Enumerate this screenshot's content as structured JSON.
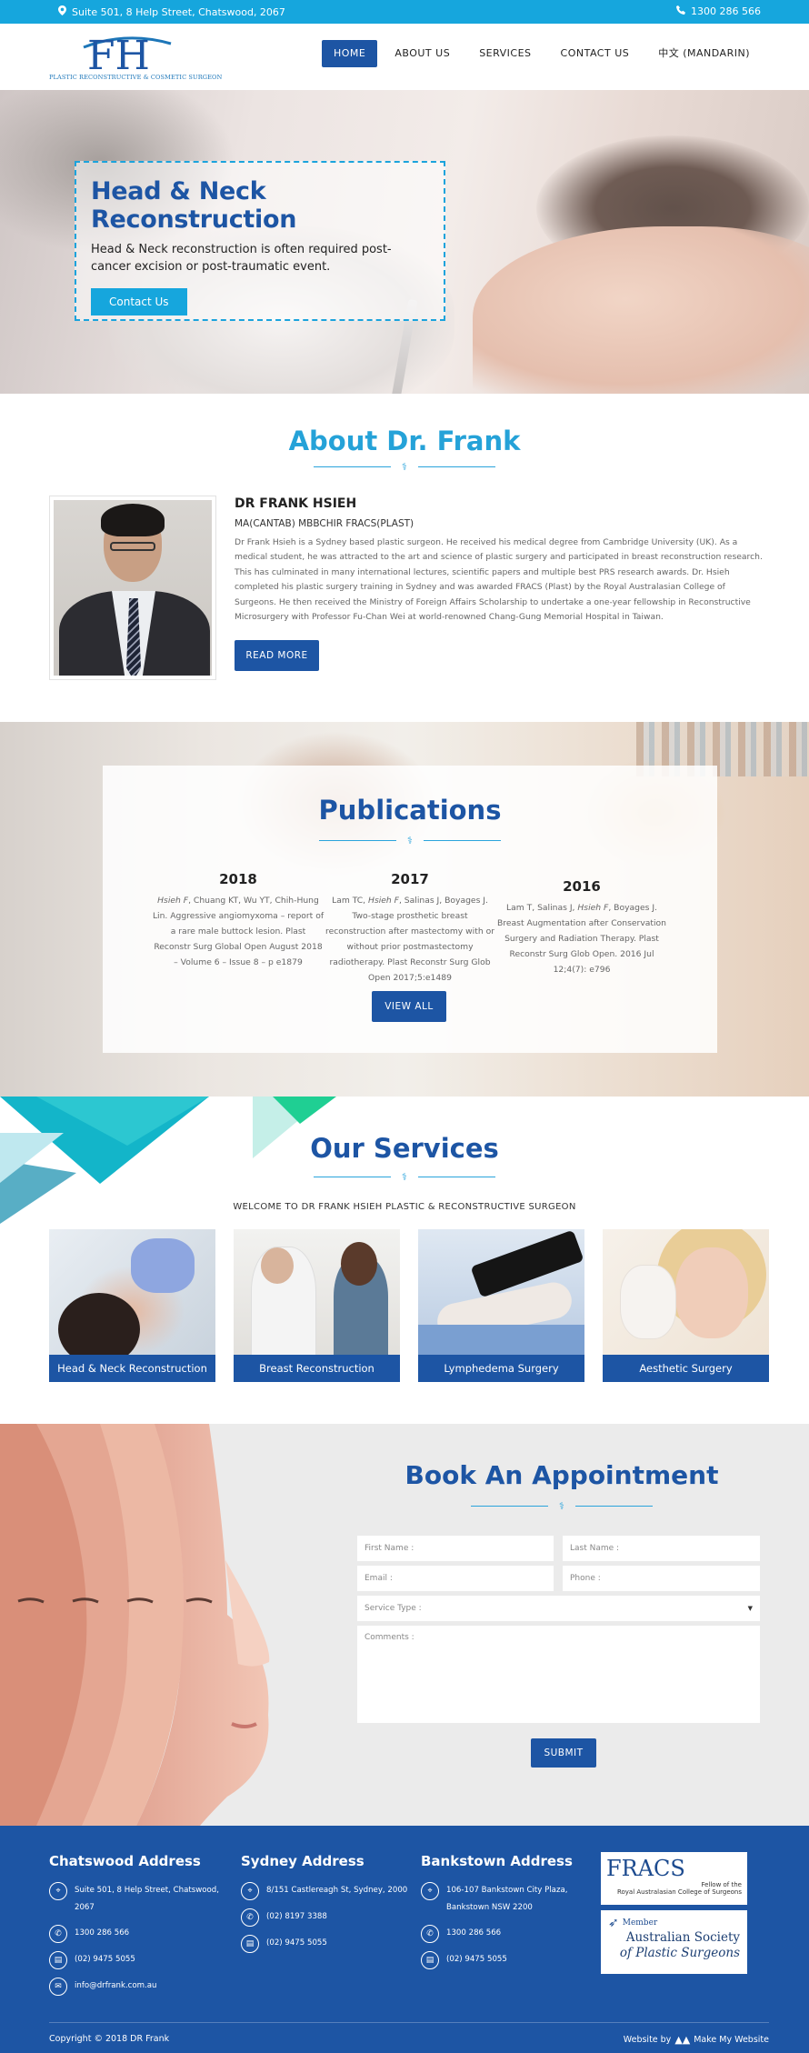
{
  "topbar": {
    "address": "Suite 501, 8 Help Street, Chatswood, 2067",
    "phone": "1300 286 566"
  },
  "logo": {
    "monogram": "FH",
    "tagline": "PLASTIC RECONSTRUCTIVE & COSMETIC SURGEON"
  },
  "nav": {
    "items": [
      "HOME",
      "ABOUT US",
      "SERVICES",
      "CONTACT US",
      "中文 (MANDARIN)"
    ]
  },
  "hero": {
    "title": "Head & Neck Reconstruction",
    "text": "Head & Neck reconstruction is often required post-cancer excision or post-traumatic event.",
    "button": "Contact Us"
  },
  "about": {
    "title": "About Dr. Frank",
    "name": "DR FRANK HSIEH",
    "credentials": "MA(CANTAB) MBBCHIR FRACS(PLAST)",
    "bio": "Dr Frank Hsieh is a Sydney based plastic surgeon. He received his medical degree from Cambridge University (UK). As a medical student, he was attracted to the art and science of plastic surgery and participated in breast reconstruction research. This has culminated in many international lectures, scientific papers and multiple best PRS research awards. Dr. Hsieh completed his plastic surgery training in Sydney and was awarded FRACS (Plast) by the Royal Australasian College of Surgeons. He then received the Ministry of Foreign Affairs Scholarship to undertake a one-year fellowship in Reconstructive Microsurgery with Professor Fu-Chan Wei at world-renowned Chang-Gung Memorial Hospital in Taiwan.",
    "button": "READ MORE"
  },
  "publications": {
    "title": "Publications",
    "items": [
      {
        "year": "2018",
        "lead": "Hsieh F",
        "text": ", Chuang KT, Wu YT, Chih-Hung Lin. Aggressive angiomyxoma – report of a rare male buttock lesion. Plast Reconstr Surg Global Open August 2018 – Volume 6 – Issue 8 – p e1879"
      },
      {
        "year": "2017",
        "pre": "Lam TC, ",
        "lead": "Hsieh F",
        "text": ", Salinas J, Boyages J. Two-stage prosthetic breast reconstruction after mastectomy with or without prior postmastectomy radiotherapy. Plast Reconstr Surg Glob Open 2017;5:e1489"
      },
      {
        "year": "2016",
        "pre": "Lam T, Salinas J, ",
        "lead": "Hsieh F",
        "text": ", Boyages J. Breast Augmentation after Conservation Surgery and Radiation Therapy. Plast Reconstr Surg Glob Open. 2016 Jul 12;4(7): e796"
      }
    ],
    "button": "VIEW ALL"
  },
  "services": {
    "title": "Our Services",
    "subtitle": "WELCOME TO DR FRANK HSIEH PLASTIC & RECONSTRUCTIVE SURGEON",
    "items": [
      "Head & Neck Reconstruction",
      "Breast Reconstruction",
      "Lymphedema Surgery",
      "Aesthetic Surgery"
    ]
  },
  "appointment": {
    "title": "Book An Appointment",
    "first_name": "First Name :",
    "last_name": "Last Name :",
    "email": "Email :",
    "phone": "Phone :",
    "service_type": "Service Type :",
    "comments": "Comments :",
    "submit": "SUBMIT"
  },
  "footer": {
    "chatswood": {
      "title": "Chatswood Address",
      "address": "Suite 501, 8 Help Street, Chatswood, 2067",
      "phone": "1300 286 566",
      "fax": "(02) 9475 5055",
      "email": "info@drfrank.com.au"
    },
    "sydney": {
      "title": "Sydney Address",
      "address": "8/151 Castlereagh St, Sydney, 2000",
      "phone": "(02) 8197 3388",
      "fax": "(02) 9475 5055"
    },
    "bankstown": {
      "title": "Bankstown Address",
      "address": "106-107 Bankstown City Plaza, Bankstown NSW 2200",
      "phone": "1300 286 566",
      "fax": "(02) 9475 5055"
    },
    "fracs": {
      "abbr": "FRACS",
      "line1": "Fellow of the",
      "line2": "Royal Australasian College of Surgeons"
    },
    "asps": {
      "member": "Member",
      "line1": "Australian Society",
      "line2": "of Plastic Surgeons"
    },
    "copyright": "Copyright © 2018 DR Frank",
    "credit_prefix": "Website by",
    "credit_name": "Make My Website"
  },
  "colors": {
    "primary": "#1d55a4",
    "accent": "#16a6dd"
  }
}
